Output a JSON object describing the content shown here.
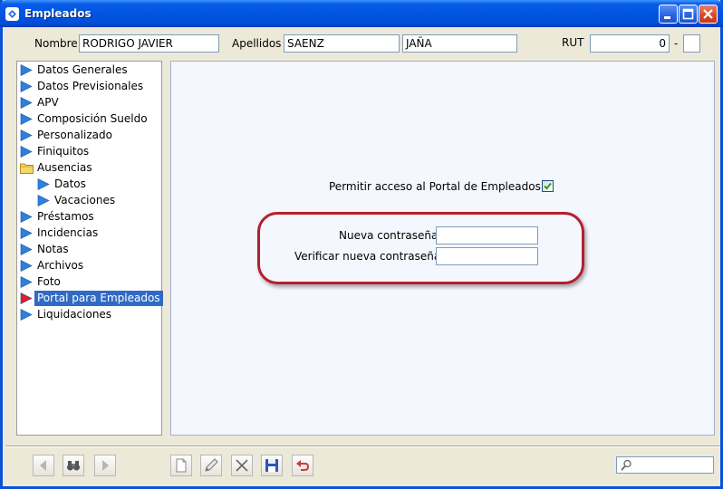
{
  "window": {
    "title": "Empleados",
    "icon": "app-icon",
    "controls": [
      "minimize-icon",
      "maximize-icon",
      "close-icon"
    ]
  },
  "header": {
    "nombre_label": "Nombre",
    "nombre_value": "RODRIGO JAVIER",
    "apellidos_label": "Apellidos",
    "apellido1_value": "SAENZ",
    "apellido2_value": "JAÑA",
    "rut_label": "RUT",
    "rut_value": "0",
    "rut_separator": "-",
    "rut_dv_value": ""
  },
  "sidebar": {
    "items": [
      {
        "label": "Datos Generales",
        "icon": "arrow-icon"
      },
      {
        "label": "Datos Previsionales",
        "icon": "arrow-icon"
      },
      {
        "label": "APV",
        "icon": "arrow-icon"
      },
      {
        "label": "Composición Sueldo",
        "icon": "arrow-icon"
      },
      {
        "label": "Personalizado",
        "icon": "arrow-icon"
      },
      {
        "label": "Finiquitos",
        "icon": "arrow-icon"
      },
      {
        "label": "Ausencias",
        "icon": "folder-icon"
      },
      {
        "label": "Datos",
        "icon": "arrow-icon"
      },
      {
        "label": "Vacaciones",
        "icon": "arrow-icon"
      },
      {
        "label": "Préstamos",
        "icon": "arrow-icon"
      },
      {
        "label": "Incidencias",
        "icon": "arrow-icon"
      },
      {
        "label": "Notas",
        "icon": "arrow-icon"
      },
      {
        "label": "Archivos",
        "icon": "arrow-icon"
      },
      {
        "label": "Foto",
        "icon": "arrow-icon"
      },
      {
        "label": "Portal para Empleados",
        "icon": "arrow-red-icon",
        "selected": true
      },
      {
        "label": "Liquidaciones",
        "icon": "arrow-icon"
      }
    ]
  },
  "portal": {
    "access_label": "Permitir acceso al Portal de Empleados",
    "access_checked": true,
    "new_password_label": "Nueva contraseña",
    "new_password_value": "",
    "verify_password_label": "Verificar nueva contraseña",
    "verify_password_value": ""
  },
  "toolbar": {
    "icons": [
      "nav-previous-icon",
      "find-binoculars-icon",
      "nav-next-icon",
      "new-document-icon",
      "edit-pencil-icon",
      "delete-x-icon",
      "save-disk-icon",
      "undo-icon"
    ],
    "search_value": "",
    "search_icon": "magnifier-icon"
  },
  "colors": {
    "titlebar": "#0054e3",
    "selection": "#316ac5",
    "highlight_ring": "#b51f2b",
    "tree_arrow": "#2f7fe0",
    "selected_arrow": "#e02020"
  }
}
